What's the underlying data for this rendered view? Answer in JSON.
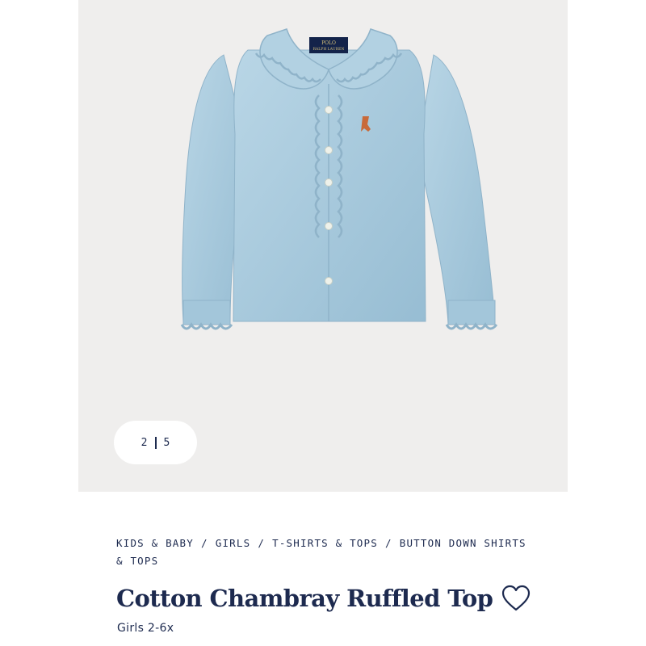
{
  "gallery": {
    "current_index": "2",
    "total": "5",
    "logo_line1": "POLO",
    "logo_line2": "RALPH LAUREN"
  },
  "breadcrumb": [
    "KIDS & BABY",
    "GIRLS",
    "T-SHIRTS & TOPS",
    "BUTTON DOWN SHIRTS & TOPS"
  ],
  "product": {
    "title": "Cotton Chambray Ruffled Top",
    "subtitle": "Girls 2-6x"
  },
  "icons": {
    "favorite": "heart-icon"
  },
  "colors": {
    "text": "#1d2a4f",
    "gallery_bg": "#efeeed",
    "shirt": "#a9cadd"
  }
}
